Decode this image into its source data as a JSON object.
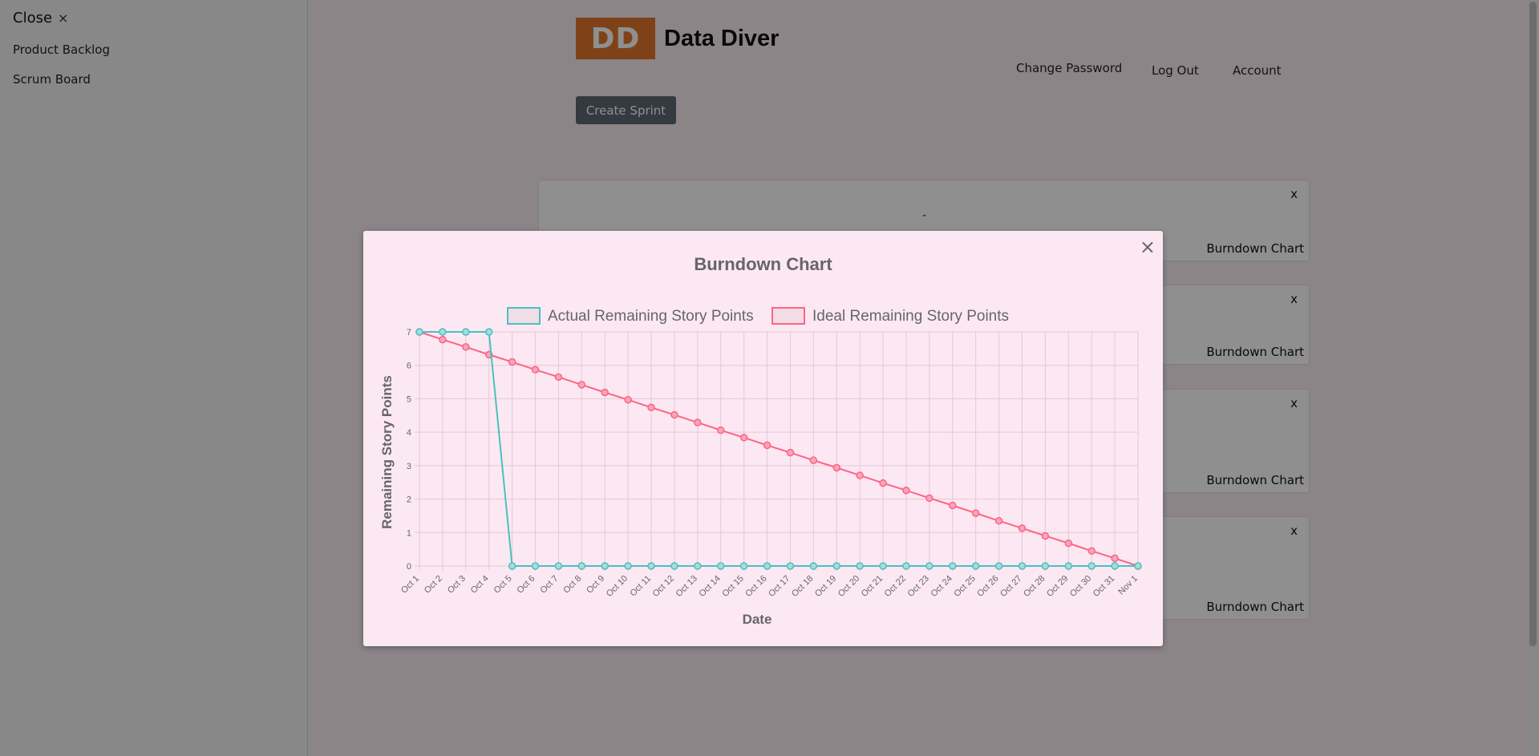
{
  "sidebar": {
    "close_label": "Close",
    "close_icon": "×",
    "items": [
      {
        "label": "Product Backlog"
      },
      {
        "label": "Scrum Board"
      }
    ]
  },
  "header": {
    "logo_text": "DD",
    "app_name": "Data Diver",
    "brand_color": "#e2772b",
    "nav": [
      {
        "label": "Change Password"
      },
      {
        "label": "Log Out"
      },
      {
        "label": "Account"
      }
    ]
  },
  "toolbar": {
    "create_label": "Create Sprint"
  },
  "cards": [
    {
      "close": "x",
      "action": "Burndown Chart",
      "text": "-"
    },
    {
      "close": "x",
      "action": "Burndown Chart"
    },
    {
      "close": "x",
      "action": "Burndown Chart"
    },
    {
      "close": "x",
      "action": "Burndown Chart"
    }
  ],
  "modal": {
    "title": "Burndown Chart",
    "close_icon": "×"
  },
  "chart_data": {
    "type": "line",
    "title": "Burndown Chart",
    "xlabel": "Date",
    "ylabel": "Remaining Story Points",
    "ylim": [
      0,
      7
    ],
    "yticks": [
      0,
      1,
      2,
      3,
      4,
      5,
      6,
      7
    ],
    "grid": true,
    "legend": "top",
    "x": [
      "Oct 1",
      "Oct 2",
      "Oct 3",
      "Oct 4",
      "Oct 5",
      "Oct 6",
      "Oct 7",
      "Oct 8",
      "Oct 9",
      "Oct 10",
      "Oct 11",
      "Oct 12",
      "Oct 13",
      "Oct 14",
      "Oct 15",
      "Oct 16",
      "Oct 17",
      "Oct 18",
      "Oct 19",
      "Oct 20",
      "Oct 21",
      "Oct 22",
      "Oct 23",
      "Oct 24",
      "Oct 25",
      "Oct 26",
      "Oct 27",
      "Oct 28",
      "Oct 29",
      "Oct 30",
      "Oct 31",
      "Nov 1"
    ],
    "series": [
      {
        "name": "Actual Remaining Story Points",
        "color": "#4bc0c0",
        "values": [
          7,
          7,
          7,
          7,
          0,
          0,
          0,
          0,
          0,
          0,
          0,
          0,
          0,
          0,
          0,
          0,
          0,
          0,
          0,
          0,
          0,
          0,
          0,
          0,
          0,
          0,
          0,
          0,
          0,
          0,
          0,
          0
        ]
      },
      {
        "name": "Ideal Remaining Story Points",
        "color": "#ff6384",
        "values": [
          7,
          6.77,
          6.55,
          6.32,
          6.1,
          5.87,
          5.65,
          5.42,
          5.19,
          4.97,
          4.74,
          4.52,
          4.29,
          4.06,
          3.84,
          3.61,
          3.39,
          3.16,
          2.94,
          2.71,
          2.48,
          2.26,
          2.03,
          1.81,
          1.58,
          1.35,
          1.13,
          0.9,
          0.68,
          0.45,
          0.23,
          0
        ]
      }
    ]
  }
}
